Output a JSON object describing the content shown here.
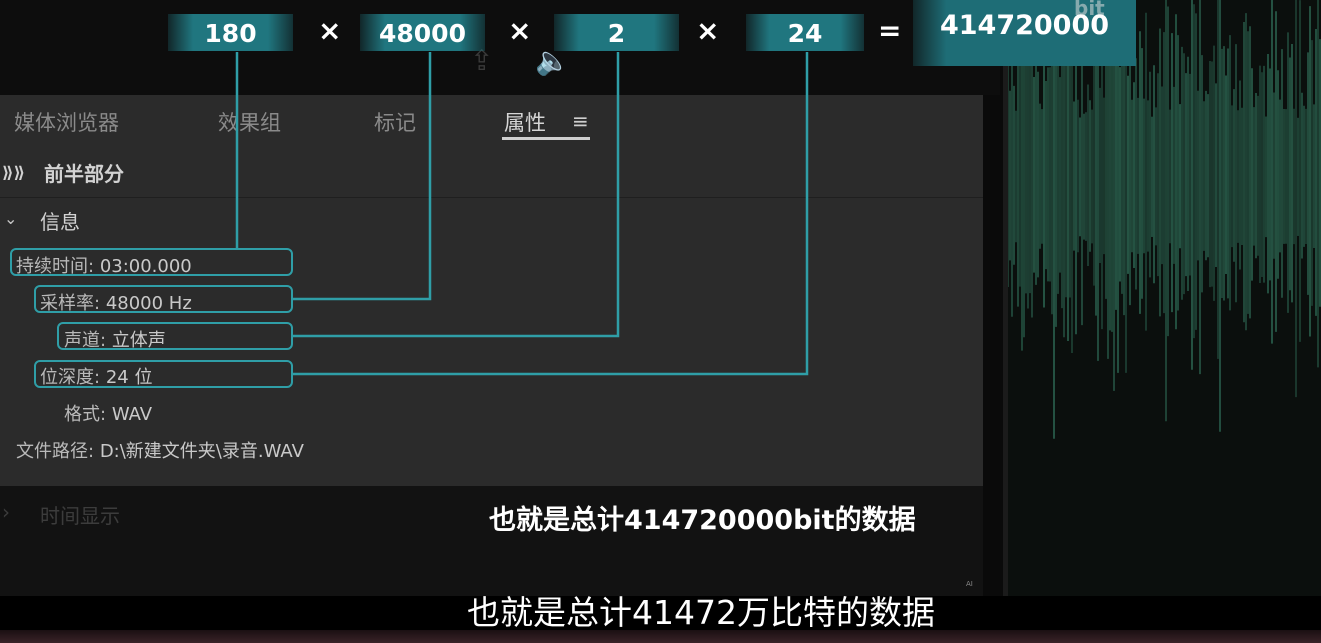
{
  "formula": {
    "terms": [
      "180",
      "48000",
      "2",
      "24"
    ],
    "operator_times": "×",
    "operator_equals": "=",
    "result": "414720000",
    "unit": "bit"
  },
  "tabs": [
    {
      "label": "媒体浏览器",
      "active": false
    },
    {
      "label": "效果组",
      "active": false
    },
    {
      "label": "标记",
      "active": false
    },
    {
      "label": "属性",
      "active": true
    }
  ],
  "tab_menu_icon": "hamburger-menu-icon",
  "clip_name": "前半部分",
  "info_section": {
    "title": "信息",
    "properties": [
      {
        "key": "持续时间:",
        "value": "03:00.000",
        "highlighted": true
      },
      {
        "key": "采样率:",
        "value": "48000 Hz",
        "highlighted": true
      },
      {
        "key": "声道:",
        "value": "立体声",
        "highlighted": true
      },
      {
        "key": "位深度:",
        "value": "24 位",
        "highlighted": true
      },
      {
        "key": "格式:",
        "value": "WAV",
        "highlighted": false
      },
      {
        "key": "文件路径:",
        "value": "D:\\新建文件夹\\录音.WAV",
        "highlighted": false
      }
    ]
  },
  "time_display_section": {
    "title": "时间显示"
  },
  "captions": {
    "overlay": "也就是总计414720000bit的数据",
    "subtitle": "也就是总计41472万比特的数据",
    "ai_mark": "AI"
  },
  "colors": {
    "accent_teal": "#2f9ea7",
    "waveform_green": "#2e6a55",
    "panel_bg": "#2b2b2b"
  }
}
